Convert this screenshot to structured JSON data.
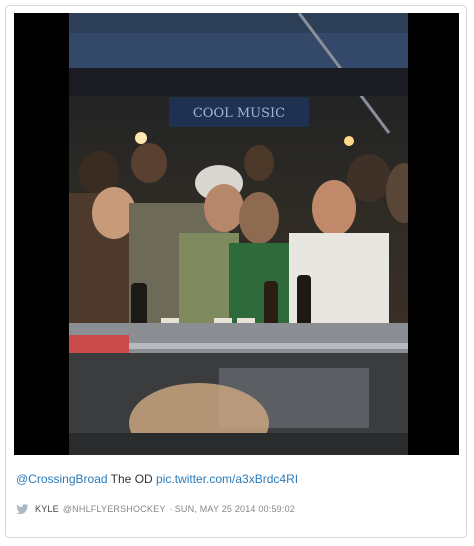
{
  "tweet": {
    "mention": "@CrossingBroad",
    "text": " The OD ",
    "link": "pic.twitter.com/a3xBrdc4RI"
  },
  "byline": {
    "author": "KYLE",
    "handle": "@NHLFLYERSHOCKEY",
    "separator": "·",
    "date": "SUN, MAY 25 2014 00:59:02"
  },
  "photo": {
    "sign_text": "COOL MUSIC",
    "icon": "twitter-bird-icon"
  },
  "colors": {
    "link": "#2b7bb9",
    "text": "#333333",
    "muted": "#888888",
    "border": "#d9d9d9"
  }
}
